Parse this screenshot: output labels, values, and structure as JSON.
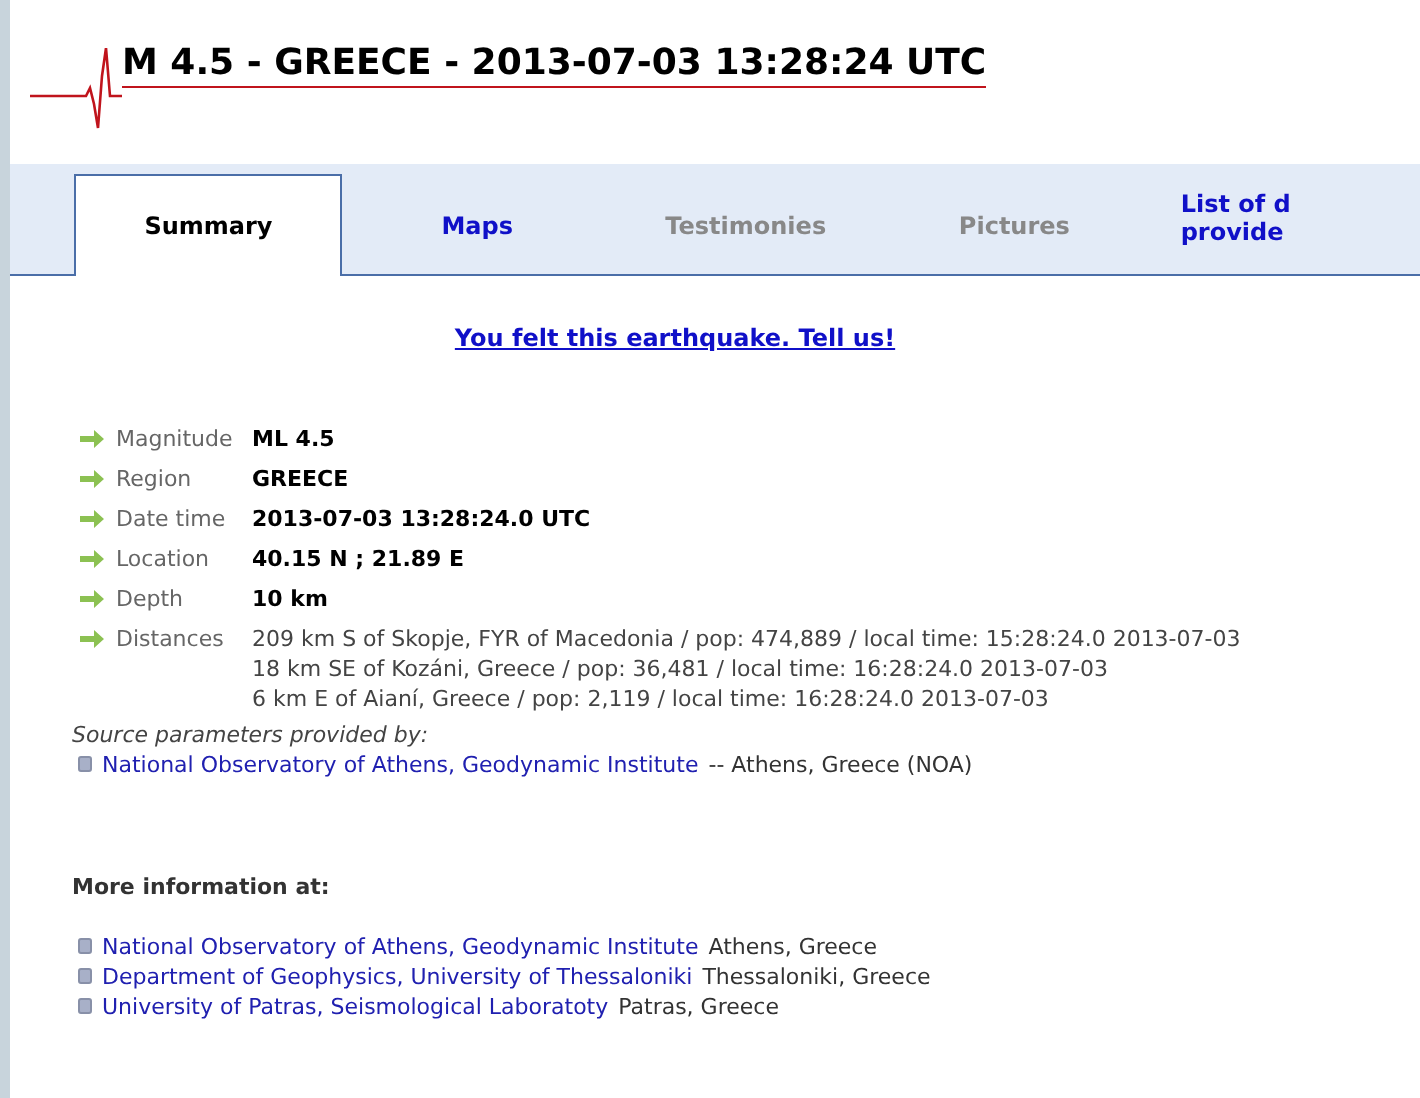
{
  "title": "M 4.5 - GREECE - 2013-07-03 13:28:24 UTC",
  "tabs": [
    {
      "label": "Summary",
      "selected": true,
      "disabled": false
    },
    {
      "label": "Maps",
      "selected": false,
      "disabled": false
    },
    {
      "label": "Testimonies",
      "selected": false,
      "disabled": true
    },
    {
      "label": "Pictures",
      "selected": false,
      "disabled": true
    },
    {
      "label": "List of d\nprovide",
      "selected": false,
      "disabled": false
    }
  ],
  "felt_link": "You felt this earthquake. Tell us!",
  "details": [
    {
      "label": "Magnitude",
      "values": [
        "ML 4.5"
      ],
      "bold": true
    },
    {
      "label": "Region",
      "values": [
        "GREECE"
      ],
      "bold": true
    },
    {
      "label": "Date time",
      "values": [
        "2013-07-03 13:28:24.0 UTC"
      ],
      "bold": true
    },
    {
      "label": "Location",
      "values": [
        "40.15 N ; 21.89 E"
      ],
      "bold": true
    },
    {
      "label": "Depth",
      "values": [
        "10 km"
      ],
      "bold": true
    },
    {
      "label": "Distances",
      "values": [
        "209 km S of Skopje, FYR of Macedonia / pop: 474,889 / local time: 15:28:24.0 2013-07-03",
        "18 km SE of Kozáni, Greece / pop: 36,481 / local time: 16:28:24.0 2013-07-03",
        "6 km E of Aianí, Greece / pop: 2,119 / local time: 16:28:24.0 2013-07-03"
      ],
      "bold": false
    }
  ],
  "source": {
    "heading": "Source parameters provided by:",
    "items": [
      {
        "link": "National Observatory of Athens, Geodynamic Institute",
        "text": "-- Athens, Greece (NOA)"
      }
    ]
  },
  "more_info": {
    "heading": "More information at:",
    "items": [
      {
        "link": "National Observatory of Athens, Geodynamic Institute",
        "text": "Athens, Greece"
      },
      {
        "link": "Department of Geophysics, University of Thessaloniki",
        "text": "Thessaloniki, Greece"
      },
      {
        "link": "University of Patras, Seismological Laboratoty",
        "text": "Patras, Greece"
      }
    ]
  }
}
